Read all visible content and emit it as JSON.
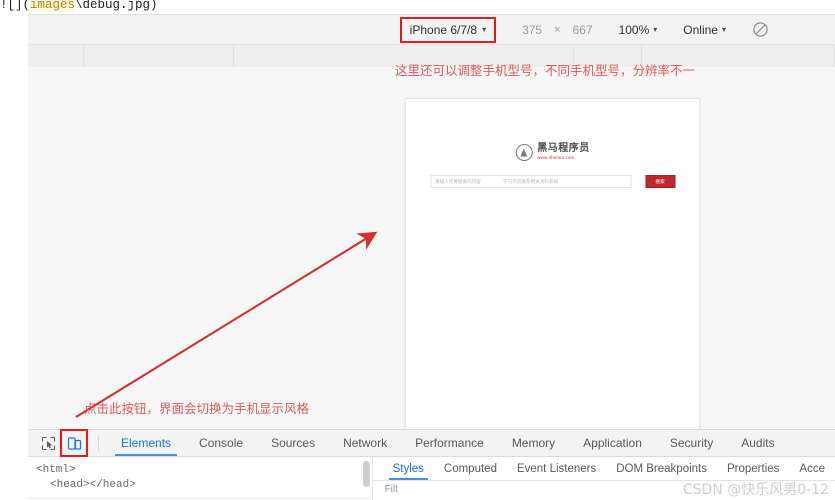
{
  "top_text": {
    "prefix": "![](",
    "highlight": "images",
    "suffix": "\\debug.jpg)"
  },
  "device_toolbar": {
    "device_label": "iPhone 6/7/8",
    "caret": "▾",
    "width": "375",
    "times": "×",
    "height": "667",
    "zoom": "100%",
    "network": "Online",
    "throttle_icon": "no-throttling-icon"
  },
  "annotations": {
    "top_note": "这里还可以调整手机型号，不同手机型号，分辨率不一",
    "left_note": "点击此按钮，界面会切换为手机显示风格",
    "arrow": "red-arrow"
  },
  "page_preview": {
    "brand_name": "黑马程序员",
    "brand_url": "www.itheima.com",
    "search_placeholder": "请输入您要搜索的内容",
    "search_hint": "学习交流群及相关资料获取",
    "search_button": "搜索"
  },
  "devtools": {
    "icons": {
      "inspect": "inspect-element-icon",
      "device_toggle": "device-toolbar-icon"
    },
    "tabs": [
      {
        "label": "Elements",
        "active": true
      },
      {
        "label": "Console",
        "active": false
      },
      {
        "label": "Sources",
        "active": false
      },
      {
        "label": "Network",
        "active": false
      },
      {
        "label": "Performance",
        "active": false
      },
      {
        "label": "Memory",
        "active": false
      },
      {
        "label": "Application",
        "active": false
      },
      {
        "label": "Security",
        "active": false
      },
      {
        "label": "Audits",
        "active": false
      }
    ],
    "dom": {
      "line1": "<html>",
      "line2": "<head></head>"
    },
    "subtabs": [
      {
        "label": "Styles",
        "active": true
      },
      {
        "label": "Computed",
        "active": false
      },
      {
        "label": "Event Listeners",
        "active": false
      },
      {
        "label": "DOM Breakpoints",
        "active": false
      },
      {
        "label": "Properties",
        "active": false
      },
      {
        "label": "Acce",
        "active": false
      }
    ],
    "filter_label": "Filt"
  },
  "watermark": "CSDN @快乐风男0-12",
  "colors": {
    "accent_blue": "#1a73e8",
    "annotation_red": "#e05a5a",
    "box_red": "#e02020",
    "brand_red": "#c0262b"
  }
}
